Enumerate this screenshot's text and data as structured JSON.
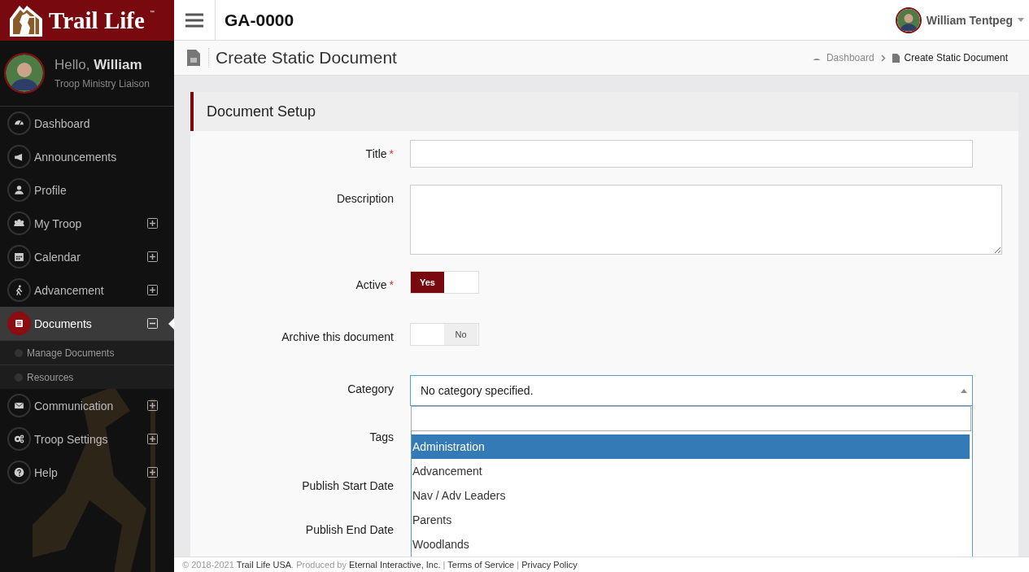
{
  "brand": {
    "name": "Trail Life",
    "mark": "™"
  },
  "user_panel": {
    "greeting": "Hello,",
    "name": "William",
    "role": "Troop Ministry Liaison"
  },
  "sidebar": {
    "items": [
      {
        "label": "Dashboard",
        "kind": "link",
        "selected": false
      },
      {
        "label": "Announcements",
        "kind": "link",
        "selected": false
      },
      {
        "label": "Profile",
        "kind": "link",
        "selected": false
      },
      {
        "label": "My Troop",
        "kind": "group",
        "expanded": false,
        "selected": false
      },
      {
        "label": "Calendar",
        "kind": "group",
        "expanded": false,
        "selected": false
      },
      {
        "label": "Advancement",
        "kind": "group",
        "expanded": false,
        "selected": false
      },
      {
        "label": "Documents",
        "kind": "group",
        "expanded": true,
        "selected": true,
        "children": [
          {
            "label": "Manage Documents"
          },
          {
            "label": "Resources"
          }
        ]
      },
      {
        "label": "Communication",
        "kind": "group",
        "expanded": false,
        "selected": false
      },
      {
        "label": "Troop Settings",
        "kind": "group",
        "expanded": false,
        "selected": false
      },
      {
        "label": "Help",
        "kind": "group",
        "expanded": false,
        "selected": false
      }
    ]
  },
  "topbar": {
    "unit": "GA-0000",
    "user": "William Tentpeg"
  },
  "page_header": {
    "title": "Create Static Document",
    "breadcrumbs": [
      "Dashboard",
      "Create Static Document"
    ]
  },
  "card": {
    "title": "Document Setup",
    "fields": [
      {
        "label": "Title",
        "required_mark": "*",
        "kind": "text"
      },
      {
        "label": "Description",
        "kind": "textarea"
      },
      {
        "label": "Active",
        "required_mark": "*",
        "kind": "toggle",
        "on": true,
        "on_label": "Yes"
      },
      {
        "label": "Archive this document",
        "kind": "toggle",
        "on": false,
        "off_label": "No"
      },
      {
        "label": "Category",
        "kind": "select",
        "value": "No category specified.",
        "open": true,
        "options": [
          {
            "label": "Administration",
            "selected": true
          },
          {
            "label": "Advancement",
            "selected": false
          },
          {
            "label": "Nav / Adv Leaders",
            "selected": false
          },
          {
            "label": "Parents",
            "selected": false
          },
          {
            "label": "Woodlands",
            "selected": false
          }
        ]
      },
      {
        "label": "Tags"
      },
      {
        "label": "Publish Start Date"
      },
      {
        "label": "Publish End Date"
      }
    ]
  },
  "footer": {
    "copyright": "© 2018-2021",
    "org": "Trail Life USA",
    "produced": ". Produced by",
    "producer": "Eternal Interactive, Inc.",
    "sep": "|",
    "terms": "Terms of Service",
    "privacy": "Privacy Policy"
  }
}
